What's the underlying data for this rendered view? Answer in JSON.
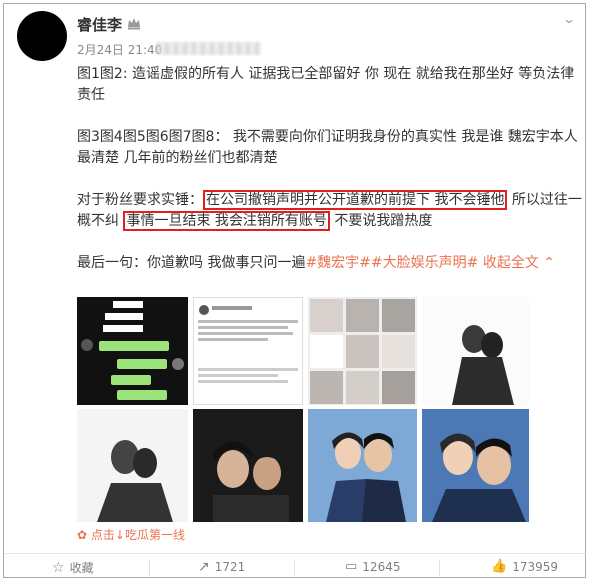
{
  "post": {
    "username": "睿佳李",
    "date": "2月24日 21:40",
    "para1": "图1图2: 造谣虚假的所有人 证据我已全部留好 你 现在 就给我在那坐好 等负法律责任",
    "para2": "图3图4图5图6图7图8： 我不需要向你们证明我身份的真实性 我是谁 魏宏宇本人最清楚 几年前的粉丝们也都清楚",
    "para3_pre": "对于粉丝要求实锤：",
    "para3_box1": "在公司撤销声明并公开道歉的前提下 我不会锤他",
    "para3_mid": "所以过往一概不纠",
    "para3_box2": "事情一旦结束 我会注销所有账号",
    "para3_post": "不要说我蹭热度",
    "para4_pre": "最后一句：你道歉吗 我做事只问一遍",
    "para4_links": "#魏宏宇##大脸娱乐声明#",
    "expand_label": "收起全文",
    "source_label": "点击↓吃瓜第一线"
  },
  "actions": {
    "favorite_label": "收藏",
    "repost_count": "1721",
    "comment_count": "12645",
    "like_count": "173959"
  },
  "images": [
    {
      "name": "chat-screenshot-1"
    },
    {
      "name": "chat-screenshot-2"
    },
    {
      "name": "photo-grid"
    },
    {
      "name": "couple-photo-1"
    },
    {
      "name": "couple-photo-2"
    },
    {
      "name": "selfie-photo"
    },
    {
      "name": "couple-photo-3"
    },
    {
      "name": "couple-photo-4"
    }
  ],
  "colors": {
    "link": "#eb7350",
    "highlight_box": "#e02020"
  }
}
